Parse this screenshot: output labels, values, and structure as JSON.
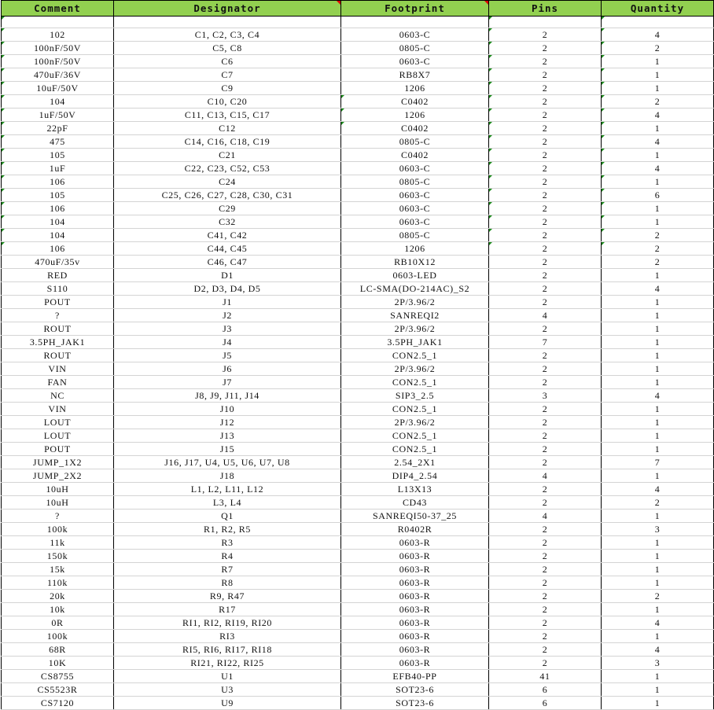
{
  "headers": [
    "Comment",
    "Designator",
    "Footprint",
    "Pins",
    "Quantity"
  ],
  "rows": [
    [
      "",
      "",
      "",
      "",
      ""
    ],
    [
      "102",
      "C1, C2, C3, C4",
      "0603-C",
      "2",
      "4"
    ],
    [
      "100nF/50V",
      "C5, C8",
      "0805-C",
      "2",
      "2"
    ],
    [
      "100nF/50V",
      "C6",
      "0603-C",
      "2",
      "1"
    ],
    [
      "470uF/36V",
      "C7",
      "RB8X7",
      "2",
      "1"
    ],
    [
      "10uF/50V",
      "C9",
      "1206",
      "2",
      "1"
    ],
    [
      "104",
      "C10, C20",
      "C0402",
      "2",
      "2"
    ],
    [
      "1uF/50V",
      "C11, C13, C15, C17",
      "1206",
      "2",
      "4"
    ],
    [
      "22pF",
      "C12",
      "C0402",
      "2",
      "1"
    ],
    [
      "475",
      "C14, C16, C18, C19",
      "0805-C",
      "2",
      "4"
    ],
    [
      "105",
      "C21",
      "C0402",
      "2",
      "1"
    ],
    [
      "1uF",
      "C22, C23, C52, C53",
      "0603-C",
      "2",
      "4"
    ],
    [
      "106",
      "C24",
      "0805-C",
      "2",
      "1"
    ],
    [
      "105",
      "C25, C26, C27, C28, C30, C31",
      "0603-C",
      "2",
      "6"
    ],
    [
      "106",
      "C29",
      "0603-C",
      "2",
      "1"
    ],
    [
      "104",
      "C32",
      "0603-C",
      "2",
      "1"
    ],
    [
      "104",
      "C41, C42",
      "0805-C",
      "2",
      "2"
    ],
    [
      "106",
      "C44, C45",
      "1206",
      "2",
      "2"
    ],
    [
      "470uF/35v",
      "C46, C47",
      "RB10X12",
      "2",
      "2"
    ],
    [
      "RED",
      "D1",
      "0603-LED",
      "2",
      "1"
    ],
    [
      "S110",
      "D2, D3, D4, D5",
      "LC-SMA(DO-214AC)_S2",
      "2",
      "4"
    ],
    [
      "POUT",
      "J1",
      "2P/3.96/2",
      "2",
      "1"
    ],
    [
      "?",
      "J2",
      "SANREQI2",
      "4",
      "1"
    ],
    [
      "ROUT",
      "J3",
      "2P/3.96/2",
      "2",
      "1"
    ],
    [
      "3.5PH_JAK1",
      "J4",
      "3.5PH_JAK1",
      "7",
      "1"
    ],
    [
      "ROUT",
      "J5",
      "CON2.5_1",
      "2",
      "1"
    ],
    [
      "VIN",
      "J6",
      "2P/3.96/2",
      "2",
      "1"
    ],
    [
      "FAN",
      "J7",
      "CON2.5_1",
      "2",
      "1"
    ],
    [
      "NC",
      "J8, J9, J11, J14",
      "SIP3_2.5",
      "3",
      "4"
    ],
    [
      "VIN",
      "J10",
      "CON2.5_1",
      "2",
      "1"
    ],
    [
      "LOUT",
      "J12",
      "2P/3.96/2",
      "2",
      "1"
    ],
    [
      "LOUT",
      "J13",
      "CON2.5_1",
      "2",
      "1"
    ],
    [
      "POUT",
      "J15",
      "CON2.5_1",
      "2",
      "1"
    ],
    [
      "JUMP_1X2",
      "J16, J17, U4, U5, U6, U7, U8",
      "2.54_2X1",
      "2",
      "7"
    ],
    [
      "JUMP_2X2",
      "J18",
      "DIP4_2.54",
      "4",
      "1"
    ],
    [
      "10uH",
      "L1, L2, L11, L12",
      "L13X13",
      "2",
      "4"
    ],
    [
      "10uH",
      "L3, L4",
      "CD43",
      "2",
      "2"
    ],
    [
      "?",
      "Q1",
      "SANREQI50-37_25",
      "4",
      "1"
    ],
    [
      "100k",
      "R1, R2, R5",
      "R0402R",
      "2",
      "3"
    ],
    [
      "11k",
      "R3",
      "0603-R",
      "2",
      "1"
    ],
    [
      "150k",
      "R4",
      "0603-R",
      "2",
      "1"
    ],
    [
      "15k",
      "R7",
      "0603-R",
      "2",
      "1"
    ],
    [
      "110k",
      "R8",
      "0603-R",
      "2",
      "1"
    ],
    [
      "20k",
      "R9, R47",
      "0603-R",
      "2",
      "2"
    ],
    [
      "10k",
      "R17",
      "0603-R",
      "2",
      "1"
    ],
    [
      "0R",
      "RI1, RI2, RI19, RI20",
      "0603-R",
      "2",
      "4"
    ],
    [
      "100k",
      "RI3",
      "0603-R",
      "2",
      "1"
    ],
    [
      "68R",
      "RI5, RI6, RI17, RI18",
      "0603-R",
      "2",
      "4"
    ],
    [
      "10K",
      "RI21, RI22, RI25",
      "0603-R",
      "2",
      "3"
    ],
    [
      "CS8755",
      "U1",
      "EFB40-PP",
      "41",
      "1"
    ],
    [
      "CS5523R",
      "U3",
      "SOT23-6",
      "6",
      "1"
    ],
    [
      "CS7120",
      "U9",
      "SOT23-6",
      "6",
      "1"
    ]
  ],
  "colors": {
    "header_fill": "#92d050",
    "comment_marker": "#e00000",
    "cell_marker": "#1a8a1a"
  }
}
